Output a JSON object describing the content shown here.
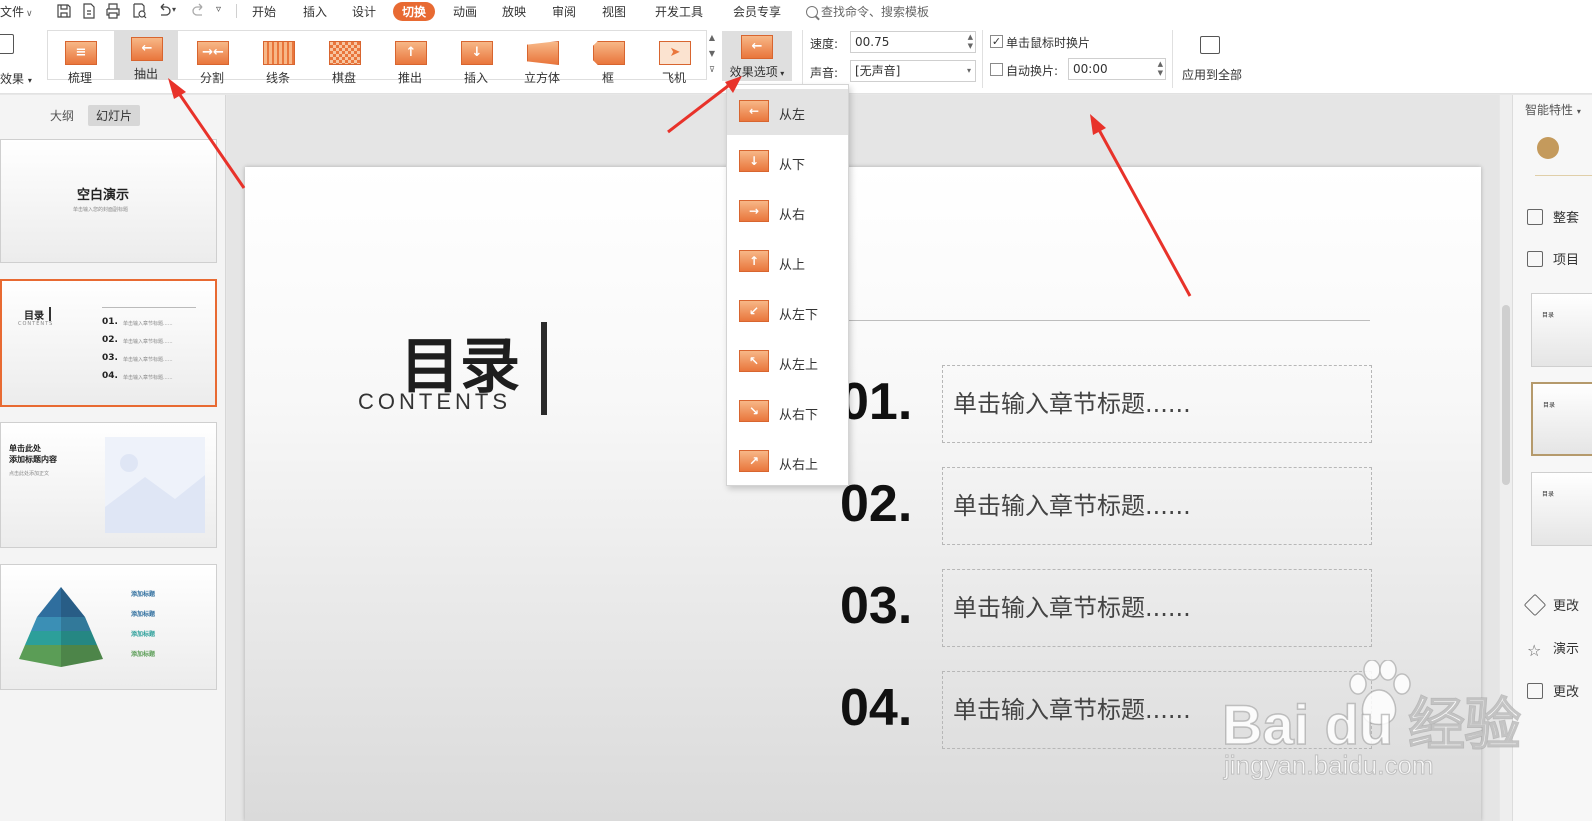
{
  "menubar": {
    "file_label": "文件",
    "tabs": [
      {
        "label": "开始"
      },
      {
        "label": "插入"
      },
      {
        "label": "设计"
      },
      {
        "label": "切换",
        "active": true
      },
      {
        "label": "动画"
      },
      {
        "label": "放映"
      },
      {
        "label": "审阅"
      },
      {
        "label": "视图"
      },
      {
        "label": "开发工具"
      },
      {
        "label": "会员专享"
      }
    ],
    "search_placeholder": "查找命令、搜索模板",
    "accent_color": "#e86a32"
  },
  "ribbon": {
    "effect_label": "效果",
    "gallery": [
      {
        "label": "梳理",
        "icon": "comb-transition-icon"
      },
      {
        "label": "抽出",
        "icon": "pull-out-transition-icon",
        "selected": true
      },
      {
        "label": "分割",
        "icon": "split-transition-icon"
      },
      {
        "label": "线条",
        "icon": "lines-transition-icon"
      },
      {
        "label": "棋盘",
        "icon": "checkerboard-transition-icon"
      },
      {
        "label": "推出",
        "icon": "push-transition-icon"
      },
      {
        "label": "插入",
        "icon": "insert-transition-icon"
      },
      {
        "label": "立方体",
        "icon": "cube-transition-icon"
      },
      {
        "label": "框",
        "icon": "box-transition-icon"
      },
      {
        "label": "飞机",
        "icon": "airplane-transition-icon"
      }
    ],
    "effect_options_label": "效果选项",
    "speed_label": "速度:",
    "speed_value": "00.75",
    "sound_label": "声音:",
    "sound_value": "[无声音]",
    "on_click_label": "单击鼠标时换片",
    "on_click_checked": true,
    "auto_label": "自动换片:",
    "auto_checked": false,
    "auto_value": "00:00",
    "apply_all_label": "应用到全部"
  },
  "effect_options_menu": [
    {
      "label": "从左",
      "selected": true
    },
    {
      "label": "从下"
    },
    {
      "label": "从右"
    },
    {
      "label": "从上"
    },
    {
      "label": "从左下"
    },
    {
      "label": "从左上"
    },
    {
      "label": "从右下"
    },
    {
      "label": "从右上"
    }
  ],
  "left_panel": {
    "tabs": [
      {
        "label": "大纲"
      },
      {
        "label": "幻灯片",
        "active": true
      }
    ],
    "slides": [
      {
        "title": "空白演示",
        "subtitle": "单击输入您的封面副标题"
      },
      {
        "title": "目录",
        "subtitle": "CONTENTS",
        "items": [
          "01.",
          "02.",
          "03.",
          "04."
        ],
        "item_text": "单击输入章节标题......"
      },
      {
        "title": "单击此处\n添加标题内容",
        "subtitle": "点击此处添加正文"
      },
      {
        "items": [
          "添加标题",
          "添加标题",
          "添加标题",
          "添加标题"
        ]
      }
    ]
  },
  "slide": {
    "title": "目录",
    "subtitle": "CONTENTS",
    "items": [
      {
        "num": "01.",
        "text": "单击输入章节标题......"
      },
      {
        "num": "02.",
        "text": "单击输入章节标题......"
      },
      {
        "num": "03.",
        "text": "单击输入章节标题......"
      },
      {
        "num": "04.",
        "text": "单击输入章节标题......"
      }
    ]
  },
  "right_panel": {
    "header": "智能特性",
    "actions": [
      {
        "label": "整套",
        "icon": "download-icon"
      },
      {
        "label": "项目",
        "icon": "list-icon"
      },
      {
        "label": "更改",
        "icon": "diamond-tag-icon"
      },
      {
        "label": "演示",
        "icon": "star-icon"
      },
      {
        "label": "更改",
        "icon": "layout-icon"
      }
    ],
    "thumb_text": "目录"
  },
  "watermark": {
    "brand": "Bai du 经验",
    "url": "jingyan.baidu.com"
  }
}
